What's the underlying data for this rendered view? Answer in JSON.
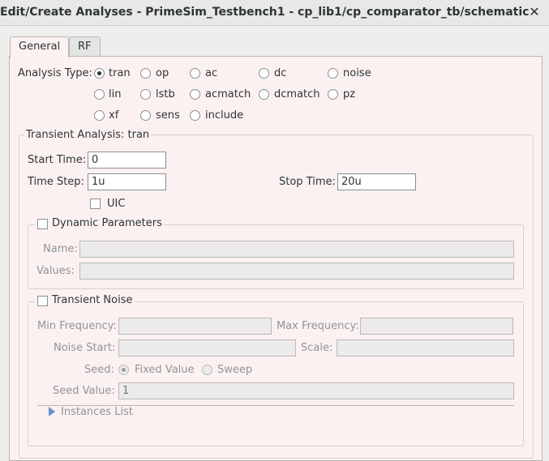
{
  "window": {
    "title": "Edit/Create Analyses - PrimeSim_Testbench1 - cp_lib1/cp_comparator_tb/schematic",
    "close_glyph": "✕"
  },
  "tabs": [
    "General",
    "RF"
  ],
  "analysis_type": {
    "label": "Analysis Type:",
    "options": [
      "tran",
      "op",
      "ac",
      "dc",
      "noise",
      "lin",
      "lstb",
      "acmatch",
      "dcmatch",
      "pz",
      "xf",
      "sens",
      "include"
    ],
    "selected": "tran"
  },
  "transient": {
    "group_title": "Transient Analysis: tran",
    "start_time_label": "Start Time:",
    "start_time_value": "0",
    "time_step_label": "Time Step:",
    "time_step_value": "1u",
    "stop_time_label": "Stop Time:",
    "stop_time_value": "20u",
    "uic_label": "UIC"
  },
  "dynamic_parameters": {
    "title": "Dynamic Parameters",
    "name_label": "Name:",
    "values_label": "Values:"
  },
  "transient_noise": {
    "title": "Transient Noise",
    "min_freq_label": "Min Frequency:",
    "max_freq_label": "Max Frequency:",
    "noise_start_label": "Noise Start:",
    "scale_label": "Scale:",
    "seed_label": "Seed:",
    "seed_options": [
      "Fixed Value",
      "Sweep"
    ],
    "seed_value_label": "Seed Value:",
    "seed_value_placeholder": "1",
    "instances_list_label": "Instances List"
  }
}
